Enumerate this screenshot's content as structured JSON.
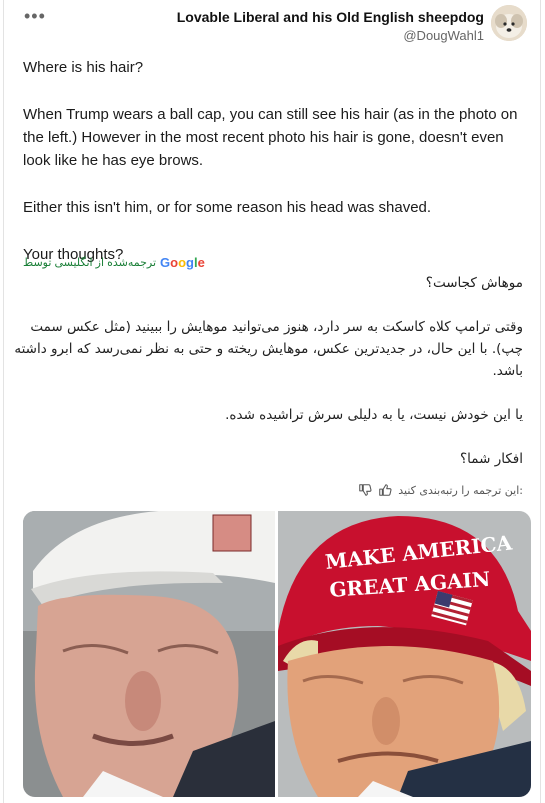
{
  "header": {
    "more_label": "•••",
    "author_name": "Lovable Liberal and his Old English sheepdog",
    "author_handle": "@DougWahl1"
  },
  "post": {
    "paragraphs": [
      "Where is his hair?",
      "When Trump wears a ball cap, you can still see his hair (as in the photo on the left.) However in the most recent photo his hair is gone, doesn't even look like he has eye brows.",
      "Either this isn't him, or for some reason his head was shaved.",
      "Your thoughts?"
    ]
  },
  "translation": {
    "provider_text": "ترجمه‌شده از انگلیسی توسط",
    "provider_logo": "Google",
    "paragraphs": [
      "موهاش کجاست؟",
      "وقتی ترامپ کلاه کاسکت به سر دارد، هنوز می‌توانید موهایش را ببینید (مثل عکس سمت چپ). با این حال، در جدیدترین عکس، موهایش ریخته و حتی به نظر نمی‌رسد که ابرو داشته باشد.",
      "یا این خودش نیست، یا به دلیلی سرش تراشیده شده.",
      "افکار شما؟"
    ],
    "rate_prompt": ":این ترجمه را رتبه‌بندی کنید"
  },
  "media": {
    "left_photo": {
      "cap_text": ""
    },
    "right_photo": {
      "cap_line1": "MAKE AMERICA",
      "cap_line2": "GREAT AGAIN"
    }
  },
  "colors": {
    "translation_green": "#1a7f37",
    "cap_red": "#c8102e"
  },
  "icons": [
    "more-options-icon",
    "thumbs-up-icon",
    "thumbs-down-icon"
  ]
}
